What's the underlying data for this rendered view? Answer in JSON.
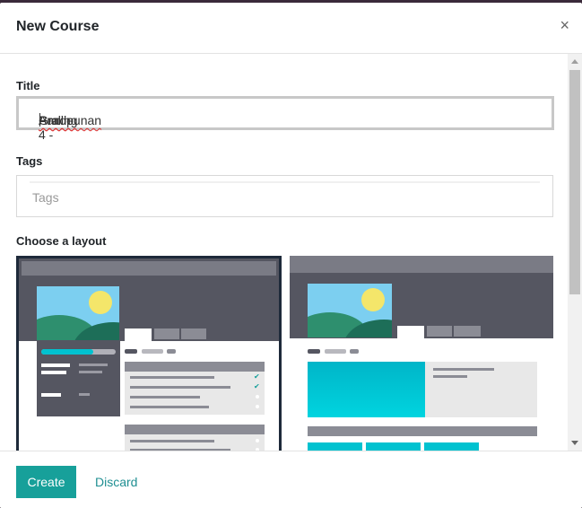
{
  "dialog": {
    "title": "New Course",
    "close_glyph": "×"
  },
  "form": {
    "title_label": "Title",
    "title_value_prefix": "Grade 4 - ",
    "title_value_word1": "Araling",
    "title_value_word2": "Panlipunan",
    "tags_label": "Tags",
    "tags_placeholder": "Tags",
    "layout_label": "Choose a layout"
  },
  "layouts": [
    {
      "name": "layout-option-1",
      "selected": true
    },
    {
      "name": "layout-option-2",
      "selected": false
    }
  ],
  "colors": {
    "accent": "#17a09a",
    "link": "#1f8f92",
    "preview_dark": "#555661",
    "preview_bar": "#7a7b85",
    "preview_teal": "#00c2d0",
    "sky": "#7ccff0",
    "sun": "#f4e66a",
    "hill": "#2e8f6e"
  },
  "footer": {
    "create_label": "Create",
    "discard_label": "Discard"
  }
}
